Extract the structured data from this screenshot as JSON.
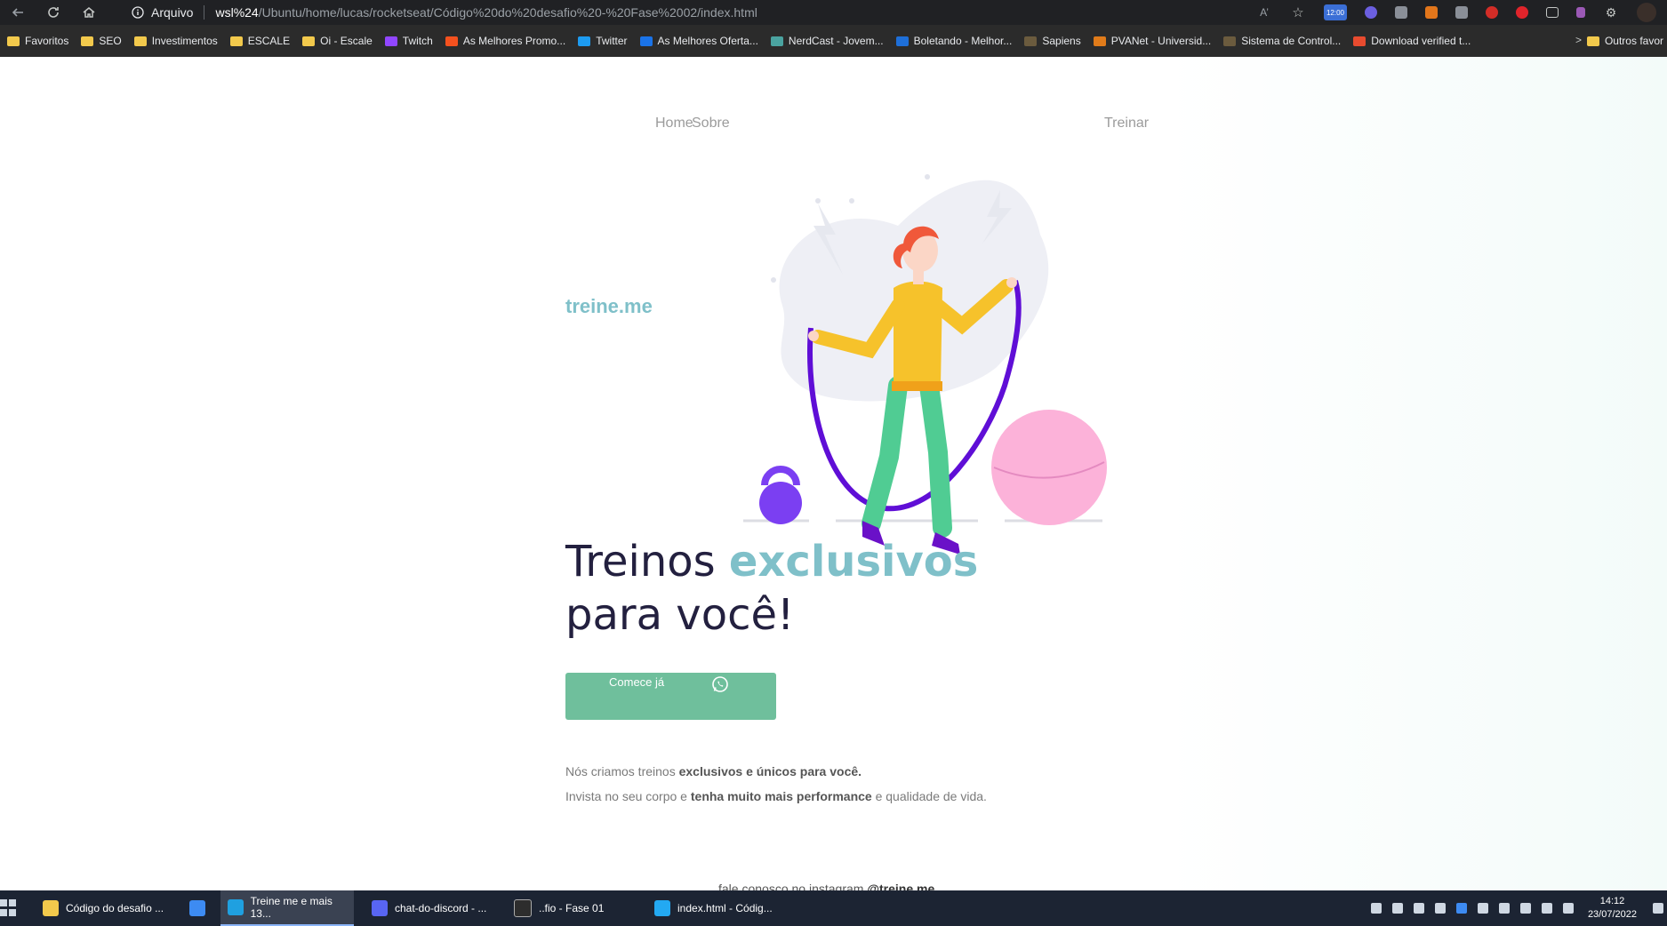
{
  "browser": {
    "security_label": "Arquivo",
    "url_host": "wsl%24",
    "url_path": "/Ubuntu/home/lucas/rocketseat/Código%20do%20desafio%20-%20Fase%2002/index.html",
    "read_aloud_label": "A’",
    "toolbar_icons": [
      "read-aloud-icon",
      "favorite-star-icon",
      "clock-extension-icon",
      "extension-icon",
      "extension-icon",
      "metamask-icon",
      "extension-icon",
      "lastpass-icon",
      "extension-icon",
      "tab-icon",
      "extension-icon",
      "extensions-puzzle-icon",
      "profile-avatar"
    ],
    "clock_badge": "12:00"
  },
  "bookmarks": {
    "items": [
      {
        "label": "Favoritos",
        "icon": "folder-icon"
      },
      {
        "label": "SEO",
        "icon": "folder-icon"
      },
      {
        "label": "Investimentos",
        "icon": "folder-icon"
      },
      {
        "label": "ESCALE",
        "icon": "folder-icon"
      },
      {
        "label": "Oi - Escale",
        "icon": "folder-icon"
      },
      {
        "label": "Twitch",
        "icon": "twitch-icon"
      },
      {
        "label": "As Melhores Promo...",
        "icon": "fire-icon"
      },
      {
        "label": "Twitter",
        "icon": "twitter-icon"
      },
      {
        "label": "As Melhores Oferta...",
        "icon": "dollar-icon"
      },
      {
        "label": "NerdCast - Jovem...",
        "icon": "nerdcast-icon"
      },
      {
        "label": "Boletando - Melhor...",
        "icon": "boletando-icon"
      },
      {
        "label": "Sapiens",
        "icon": "sapiens-icon"
      },
      {
        "label": "PVANet - Universid...",
        "icon": "pvanet-icon"
      },
      {
        "label": "Sistema de Control...",
        "icon": "sistema-icon"
      },
      {
        "label": "Download verified t...",
        "icon": "x-icon"
      }
    ],
    "more_symbol": ">",
    "other_label": "Outros favor"
  },
  "page": {
    "nav": {
      "home": "Home",
      "about": "Sobre",
      "train": "Treinar"
    },
    "brand": "treine.me",
    "headline": {
      "part1": "Treinos ",
      "accent": "exclusivos",
      "part2": "para você!"
    },
    "cta_label": "Comece já",
    "desc_line1": {
      "a": "Nós criamos treinos ",
      "b": "exclusivos e únicos para você."
    },
    "desc_line2": {
      "a": "Invista no seu corpo e ",
      "b": "tenha muito mais performance",
      "c": " e qualidade de vida."
    },
    "footer": {
      "text": "fale conosco no instagram ",
      "handle": "@treine.me"
    }
  },
  "colors": {
    "accent": "#7fc0c9",
    "cta": "#6fbf9c",
    "headline": "#23203f"
  },
  "taskbar": {
    "tasks": [
      {
        "label": "Código do desafio ...",
        "icon": "file-explorer-icon"
      },
      {
        "label": "",
        "icon": "store-icon"
      },
      {
        "label": "Treine me e mais 13...",
        "icon": "edge-icon"
      },
      {
        "label": "chat-do-discord - ...",
        "icon": "discord-icon"
      },
      {
        "label": "..fio - Fase 01",
        "icon": "terminal-icon"
      },
      {
        "label": "index.html - Códig...",
        "icon": "vscode-icon"
      }
    ],
    "time": "14:12",
    "date": "23/07/2022"
  }
}
